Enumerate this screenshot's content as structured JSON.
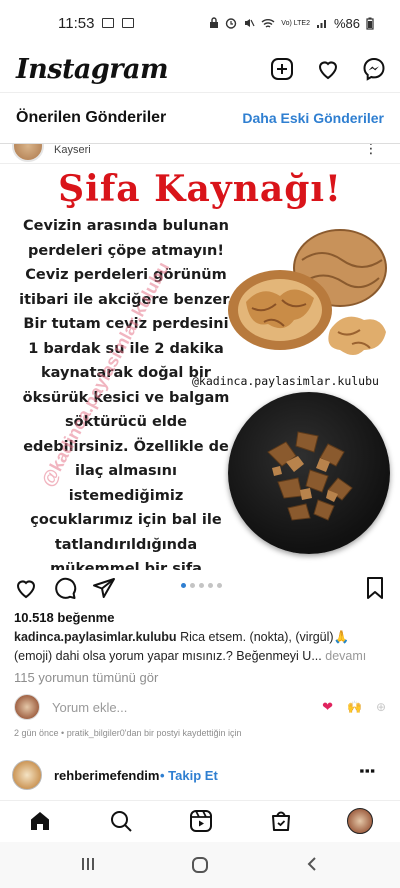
{
  "status_bar": {
    "time": "11:53",
    "network": "Vo) LTE2",
    "battery": "%86"
  },
  "header": {
    "app_title": "Instagram",
    "icons": [
      "new-post-icon",
      "heart-icon",
      "messenger-icon"
    ]
  },
  "suggested": {
    "title": "Önerilen Gönderiler",
    "older_link": "Daha Eski Gönderiler"
  },
  "previous_post": {
    "location": "Kayseri"
  },
  "post": {
    "image": {
      "title": "Şifa Kaynağı!",
      "body": "Cevizin arasında bulunan perdeleri çöpe atmayın! Ceviz perdeleri görünüm itibari ile akciğere benzer. Bir tutam ceviz perdesini 1 bardak su ile 2 dakika kaynatarak doğal bir öksürük kesici ve balgam söktürücü elde edebilirsiniz. Özellikle de ilaç almasını istemediğimiz çocuklarımız için bal ile tatlandırıldığında mükemmel bir şifa kaynağı.",
      "handle": "@kadinca.paylasimlar.kulubu",
      "watermark": "@kadinca.paylasimlar.kulubu"
    },
    "carousel_total": 5,
    "carousel_active": 1,
    "likes": "10.518 beğenme",
    "caption_user": "kadinca.paylasimlar.kulubu",
    "caption_text": "Rica etsem. (nokta), (virgül)🙏 (emoji) dahi olsa yorum yapar mısınız.? Beğenmeyi U...",
    "caption_more": "devamı",
    "view_comments": "115 yorumun tümünü gör",
    "comment_placeholder": "Yorum ekle...",
    "quick_emojis": [
      "❤",
      "🙌",
      "⊕"
    ],
    "meta": "2 gün önce • pratik_bilgiler0'dan bir postyi kaydettiğin için"
  },
  "next_post": {
    "username": "rehberimefendim",
    "follow": "Takip Et"
  },
  "bottom_nav": [
    "home-icon",
    "search-icon",
    "reels-icon",
    "shop-icon",
    "profile-avatar"
  ],
  "colors": {
    "accent_blue": "#2f7fd1",
    "title_red": "#d9141a",
    "like_red": "#e0245e"
  }
}
